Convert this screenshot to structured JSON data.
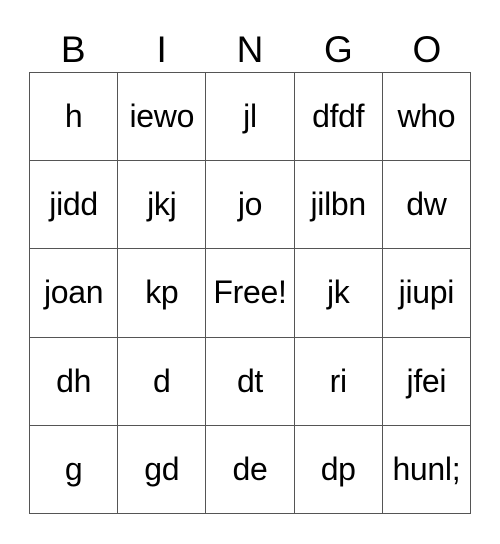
{
  "header": [
    "B",
    "I",
    "N",
    "G",
    "O"
  ],
  "cells": [
    [
      "h",
      "iewo",
      "jl",
      "dfdf",
      "who"
    ],
    [
      "jidd",
      "jkj",
      "jo",
      "jilbn",
      "dw"
    ],
    [
      "joan",
      "kp",
      "Free!",
      "jk",
      "jiupi"
    ],
    [
      "dh",
      "d",
      "dt",
      "ri",
      "jfei"
    ],
    [
      "g",
      "gd",
      "de",
      "dp",
      "hunl;"
    ]
  ]
}
